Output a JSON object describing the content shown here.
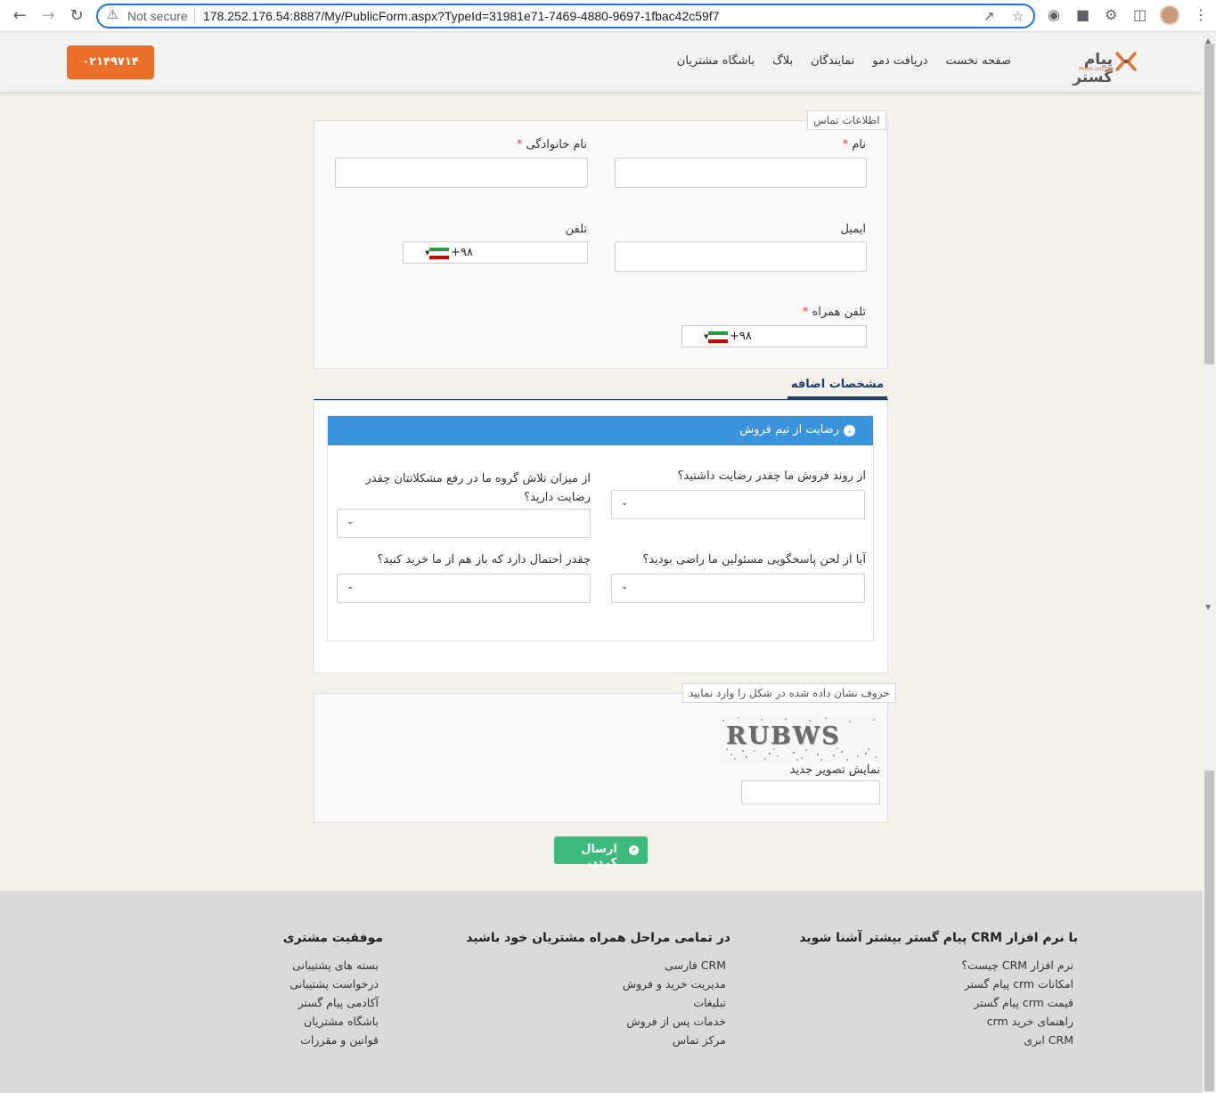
{
  "browser": {
    "security_label": "Not secure",
    "url": "178.252.176.54:8887/My/PublicForm.aspx?TypeId=31981e71-7469-4880-9697-1fbac42c59f7"
  },
  "header": {
    "phone": "۰۲۱۴۹۷۱۴",
    "nav": [
      "صفحه نخست",
      "دریافت دمو",
      "نمایندگان",
      "بلاگ",
      "باشگاه مشتریان"
    ],
    "logo_text": "پیام گستر",
    "logo_sub": "PAYAM GOSTAR",
    "brand_color": "#e8702a"
  },
  "contact": {
    "legend": "اطلاعات تماس",
    "first_name_label": "نام",
    "last_name_label": "نام خانوادگی",
    "email_label": "ایمیل",
    "phone_label": "تلفن",
    "mobile_label": "تلفن همراه",
    "country_code": "+۹۸",
    "required_mark": "*"
  },
  "extra": {
    "tab": "مشخصات اضافه",
    "section_title": "رضایت از تیم فروش",
    "q1": "از روند فروش ما چقدر رضایت داشتید؟",
    "q2": "از میزان تلاش گروه ما در رفع مشکلاتتان چقدر رضایت دارید؟",
    "q3": "آیا از لحن پاسخگویی مسئولین ما راضی بودید؟",
    "q4": "چقدر احتمال دارد که باز هم از ما خرید کنید؟",
    "accent_color": "#3a94dd"
  },
  "captcha": {
    "legend": "حروف نشان داده شده در شکل را وارد نمایید",
    "image_text": "RUBWS",
    "refresh_label": "نمایش تصویر جدید"
  },
  "submit": {
    "label": "ارسال کردن",
    "color": "#3cba7c"
  },
  "footer": {
    "columns": [
      {
        "title": "با نرم افزار CRM پیام گستر بیشتر آشنا شوید",
        "links": [
          "نرم افزار CRM چیست؟",
          "امکانات crm پیام گستر",
          "قیمت crm پیام گستر",
          "راهنمای خرید crm",
          "CRM ابری"
        ]
      },
      {
        "title": "در تمامی مراحل همراه مشتریان خود باشید",
        "links": [
          "CRM فارسی",
          "مدیریت خرید و فروش",
          "تبلیغات",
          "خدمات پس از فروش",
          "مرکز تماس"
        ]
      },
      {
        "title": "موفقیت مشتری",
        "links": [
          "بسته های پشتیبانی",
          "درخواست پشتیبانی",
          "آکادمی پیام گستر",
          "باشگاه مشتریان",
          "قوانین و مقررات"
        ]
      }
    ]
  }
}
